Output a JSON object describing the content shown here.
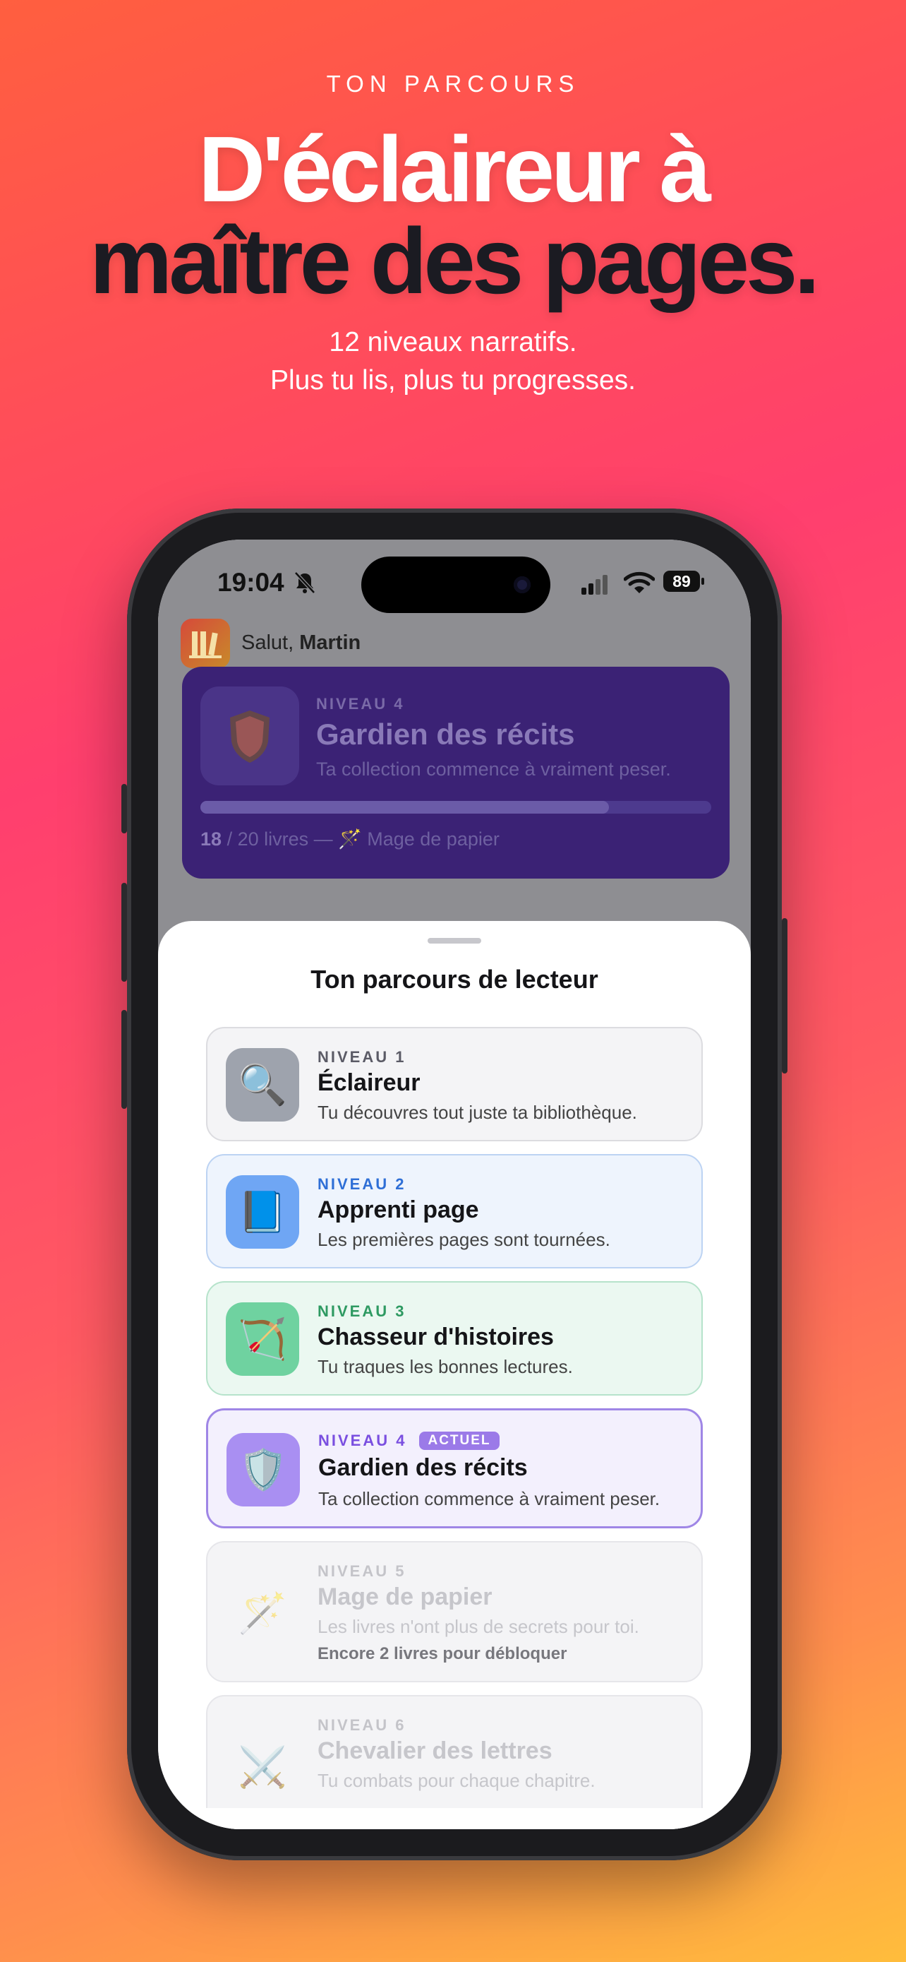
{
  "hero": {
    "eyebrow": "TON PARCOURS",
    "title_line1": "D'éclaireur à",
    "title_line2": "maître des pages.",
    "subtitle_line1": "12 niveaux narratifs.",
    "subtitle_line2": "Plus tu lis, plus tu progresses."
  },
  "status_bar": {
    "time": "19:04",
    "battery": "89"
  },
  "home": {
    "greeting": "Salut,",
    "user_name": "Martin",
    "current_level": {
      "eyebrow": "NIVEAU 4",
      "title": "Gardien des récits",
      "description": "Ta collection commence à vraiment peser.",
      "books_read": "18",
      "books_rest": "/ 20 livres — 🪄 Mage de papier",
      "progress": 0.8
    }
  },
  "sheet": {
    "title": "Ton parcours de lecteur",
    "levels": [
      {
        "eyebrow": "NIVEAU 1",
        "name": "Éclaireur",
        "description": "Tu découvres tout juste ta bibliothèque.",
        "icon": "🔍",
        "icon_name": "magnifier-icon",
        "accent": "#5b5b66"
      },
      {
        "eyebrow": "NIVEAU 2",
        "name": "Apprenti page",
        "description": "Les premières pages sont tournées.",
        "icon": "📘",
        "icon_name": "book-icon",
        "accent": "#2f6fd6"
      },
      {
        "eyebrow": "NIVEAU 3",
        "name": "Chasseur d'histoires",
        "description": "Tu traques les bonnes lectures.",
        "icon": "🏹",
        "icon_name": "bow-arrow-icon",
        "accent": "#2e9a62"
      },
      {
        "eyebrow": "NIVEAU 4",
        "badge": "ACTUEL",
        "name": "Gardien des récits",
        "description": "Ta collection commence à vraiment peser.",
        "icon": "🛡️",
        "icon_name": "shield-icon",
        "accent": "#7a4fe0"
      },
      {
        "eyebrow": "NIVEAU 5",
        "name": "Mage de papier",
        "description": "Les livres n'ont plus de secrets pour toi.",
        "unlock": "Encore 2 livres pour débloquer",
        "icon": "🪄",
        "icon_name": "magic-wand-icon"
      },
      {
        "eyebrow": "NIVEAU 6",
        "name": "Chevalier des lettres",
        "description": "Tu combats pour chaque chapitre.",
        "icon": "⚔️",
        "icon_name": "crossed-swords-icon"
      }
    ]
  }
}
